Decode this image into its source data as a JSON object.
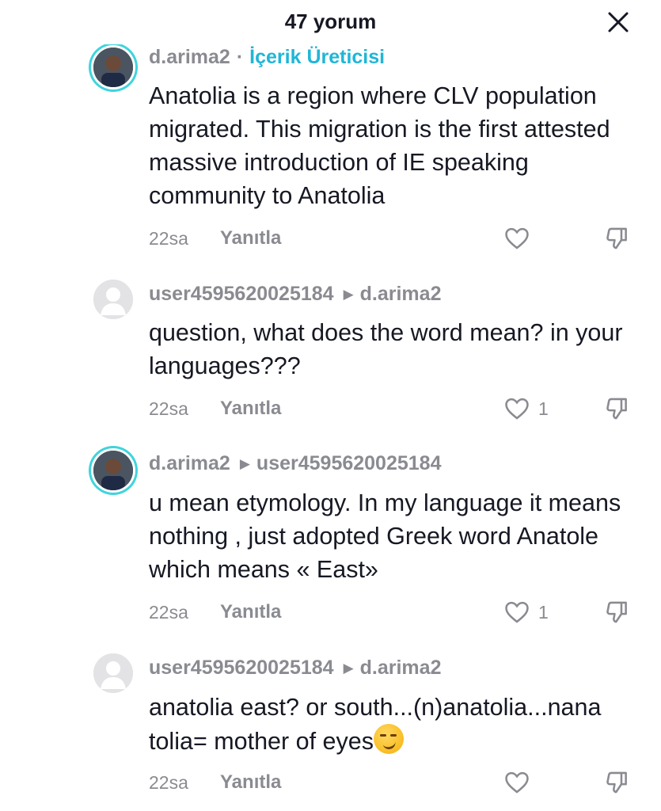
{
  "header": {
    "title": "47 yorum",
    "close_icon": "close-icon"
  },
  "comments": [
    {
      "author": "d.arima2",
      "separator": "·",
      "creator_label": "İçerik Üreticisi",
      "text": "Anatolia is a region where CLV population migrated. This migration is the first attested massive introduction of IE speaking community to Anatolia",
      "time": "22sa",
      "reply_label": "Yanıtla",
      "likes": ""
    },
    {
      "author": "user4595620025184",
      "reply_to": "d.arima2",
      "text": "question, what does the word mean? in your languages???",
      "time": "22sa",
      "reply_label": "Yanıtla",
      "likes": "1"
    },
    {
      "author": "d.arima2",
      "reply_to": "user4595620025184",
      "text": "u mean etymology. In my language it means nothing , just adopted Greek word Anatole which means « East»",
      "time": "22sa",
      "reply_label": "Yanıtla",
      "likes": "1"
    },
    {
      "author": "user4595620025184",
      "reply_to": "d.arima2",
      "text": "anatolia east? or south...(n)anatolia...nana tolia= mother of eyes",
      "emoji": "smirk-emoji",
      "time": "22sa",
      "reply_label": "Yanıtla",
      "likes": ""
    }
  ],
  "colors": {
    "accent": "#3fd4dc",
    "creator": "#20b6d6",
    "muted": "#8a8b91",
    "text": "#161823"
  }
}
